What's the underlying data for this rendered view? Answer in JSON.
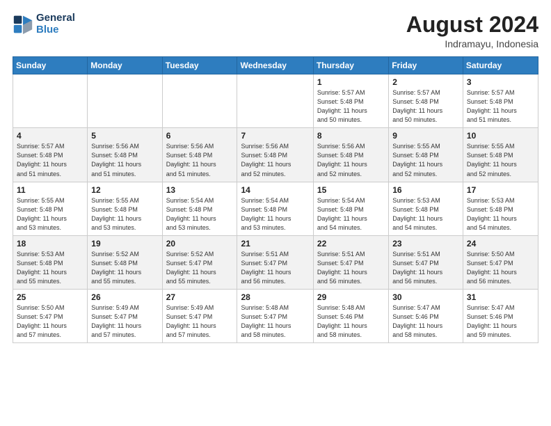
{
  "header": {
    "logo_line1": "General",
    "logo_line2": "Blue",
    "month_year": "August 2024",
    "location": "Indramayu, Indonesia"
  },
  "weekdays": [
    "Sunday",
    "Monday",
    "Tuesday",
    "Wednesday",
    "Thursday",
    "Friday",
    "Saturday"
  ],
  "weeks": [
    [
      {
        "day": "",
        "info": ""
      },
      {
        "day": "",
        "info": ""
      },
      {
        "day": "",
        "info": ""
      },
      {
        "day": "",
        "info": ""
      },
      {
        "day": "1",
        "info": "Sunrise: 5:57 AM\nSunset: 5:48 PM\nDaylight: 11 hours\nand 50 minutes."
      },
      {
        "day": "2",
        "info": "Sunrise: 5:57 AM\nSunset: 5:48 PM\nDaylight: 11 hours\nand 50 minutes."
      },
      {
        "day": "3",
        "info": "Sunrise: 5:57 AM\nSunset: 5:48 PM\nDaylight: 11 hours\nand 51 minutes."
      }
    ],
    [
      {
        "day": "4",
        "info": "Sunrise: 5:57 AM\nSunset: 5:48 PM\nDaylight: 11 hours\nand 51 minutes."
      },
      {
        "day": "5",
        "info": "Sunrise: 5:56 AM\nSunset: 5:48 PM\nDaylight: 11 hours\nand 51 minutes."
      },
      {
        "day": "6",
        "info": "Sunrise: 5:56 AM\nSunset: 5:48 PM\nDaylight: 11 hours\nand 51 minutes."
      },
      {
        "day": "7",
        "info": "Sunrise: 5:56 AM\nSunset: 5:48 PM\nDaylight: 11 hours\nand 52 minutes."
      },
      {
        "day": "8",
        "info": "Sunrise: 5:56 AM\nSunset: 5:48 PM\nDaylight: 11 hours\nand 52 minutes."
      },
      {
        "day": "9",
        "info": "Sunrise: 5:55 AM\nSunset: 5:48 PM\nDaylight: 11 hours\nand 52 minutes."
      },
      {
        "day": "10",
        "info": "Sunrise: 5:55 AM\nSunset: 5:48 PM\nDaylight: 11 hours\nand 52 minutes."
      }
    ],
    [
      {
        "day": "11",
        "info": "Sunrise: 5:55 AM\nSunset: 5:48 PM\nDaylight: 11 hours\nand 53 minutes."
      },
      {
        "day": "12",
        "info": "Sunrise: 5:55 AM\nSunset: 5:48 PM\nDaylight: 11 hours\nand 53 minutes."
      },
      {
        "day": "13",
        "info": "Sunrise: 5:54 AM\nSunset: 5:48 PM\nDaylight: 11 hours\nand 53 minutes."
      },
      {
        "day": "14",
        "info": "Sunrise: 5:54 AM\nSunset: 5:48 PM\nDaylight: 11 hours\nand 53 minutes."
      },
      {
        "day": "15",
        "info": "Sunrise: 5:54 AM\nSunset: 5:48 PM\nDaylight: 11 hours\nand 54 minutes."
      },
      {
        "day": "16",
        "info": "Sunrise: 5:53 AM\nSunset: 5:48 PM\nDaylight: 11 hours\nand 54 minutes."
      },
      {
        "day": "17",
        "info": "Sunrise: 5:53 AM\nSunset: 5:48 PM\nDaylight: 11 hours\nand 54 minutes."
      }
    ],
    [
      {
        "day": "18",
        "info": "Sunrise: 5:53 AM\nSunset: 5:48 PM\nDaylight: 11 hours\nand 55 minutes."
      },
      {
        "day": "19",
        "info": "Sunrise: 5:52 AM\nSunset: 5:48 PM\nDaylight: 11 hours\nand 55 minutes."
      },
      {
        "day": "20",
        "info": "Sunrise: 5:52 AM\nSunset: 5:47 PM\nDaylight: 11 hours\nand 55 minutes."
      },
      {
        "day": "21",
        "info": "Sunrise: 5:51 AM\nSunset: 5:47 PM\nDaylight: 11 hours\nand 56 minutes."
      },
      {
        "day": "22",
        "info": "Sunrise: 5:51 AM\nSunset: 5:47 PM\nDaylight: 11 hours\nand 56 minutes."
      },
      {
        "day": "23",
        "info": "Sunrise: 5:51 AM\nSunset: 5:47 PM\nDaylight: 11 hours\nand 56 minutes."
      },
      {
        "day": "24",
        "info": "Sunrise: 5:50 AM\nSunset: 5:47 PM\nDaylight: 11 hours\nand 56 minutes."
      }
    ],
    [
      {
        "day": "25",
        "info": "Sunrise: 5:50 AM\nSunset: 5:47 PM\nDaylight: 11 hours\nand 57 minutes."
      },
      {
        "day": "26",
        "info": "Sunrise: 5:49 AM\nSunset: 5:47 PM\nDaylight: 11 hours\nand 57 minutes."
      },
      {
        "day": "27",
        "info": "Sunrise: 5:49 AM\nSunset: 5:47 PM\nDaylight: 11 hours\nand 57 minutes."
      },
      {
        "day": "28",
        "info": "Sunrise: 5:48 AM\nSunset: 5:47 PM\nDaylight: 11 hours\nand 58 minutes."
      },
      {
        "day": "29",
        "info": "Sunrise: 5:48 AM\nSunset: 5:46 PM\nDaylight: 11 hours\nand 58 minutes."
      },
      {
        "day": "30",
        "info": "Sunrise: 5:47 AM\nSunset: 5:46 PM\nDaylight: 11 hours\nand 58 minutes."
      },
      {
        "day": "31",
        "info": "Sunrise: 5:47 AM\nSunset: 5:46 PM\nDaylight: 11 hours\nand 59 minutes."
      }
    ]
  ]
}
